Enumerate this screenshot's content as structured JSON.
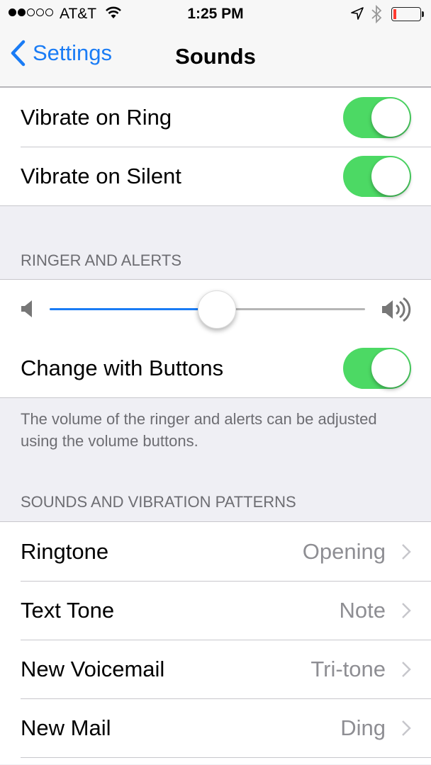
{
  "status_bar": {
    "signal_bars_filled": 2,
    "signal_bars_total": 5,
    "carrier": "AT&T",
    "time": "1:25 PM",
    "battery_level_percent": 10,
    "icons": [
      "signal-dots",
      "wifi-icon",
      "location-arrow-icon",
      "bluetooth-icon",
      "battery-icon"
    ]
  },
  "nav": {
    "back_label": "Settings",
    "title": "Sounds"
  },
  "vibrate_group": [
    {
      "label": "Vibrate on Ring",
      "on": true
    },
    {
      "label": "Vibrate on Silent",
      "on": true
    }
  ],
  "ringer": {
    "header": "RINGER AND ALERTS",
    "volume_fraction": 0.53,
    "change_with_buttons": {
      "label": "Change with Buttons",
      "on": true
    },
    "footer": "The volume of the ringer and alerts can be adjusted using the volume buttons."
  },
  "sounds": {
    "header": "SOUNDS AND VIBRATION PATTERNS",
    "items": [
      {
        "label": "Ringtone",
        "value": "Opening"
      },
      {
        "label": "Text Tone",
        "value": "Note"
      },
      {
        "label": "New Voicemail",
        "value": "Tri-tone"
      },
      {
        "label": "New Mail",
        "value": "Ding"
      }
    ]
  },
  "colors": {
    "accent": "#1a7cf5",
    "toggle_on": "#4cd964",
    "battery_low": "#ff3b30"
  }
}
